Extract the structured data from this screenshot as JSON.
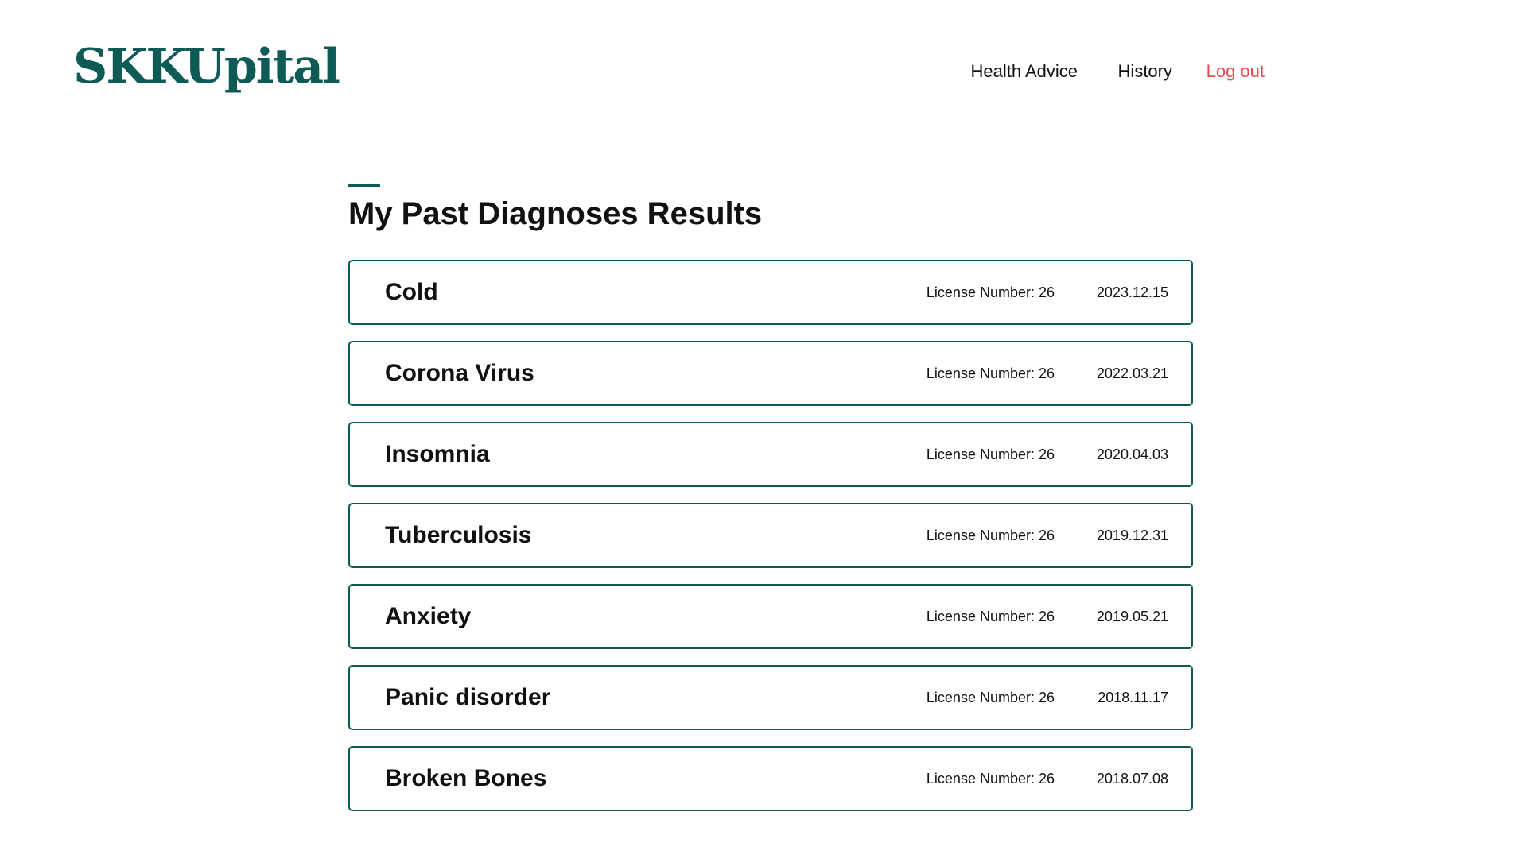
{
  "header": {
    "logo": "SKKUpital",
    "nav": {
      "health_advice": "Health Advice",
      "history": "History",
      "logout": "Log out"
    }
  },
  "main": {
    "title": "My Past Diagnoses Results",
    "diagnoses": [
      {
        "name": "Cold",
        "license": "License Number: 26",
        "date": "2023.12.15"
      },
      {
        "name": "Corona Virus",
        "license": "License Number: 26",
        "date": "2022.03.21"
      },
      {
        "name": "Insomnia",
        "license": "License Number: 26",
        "date": "2020.04.03"
      },
      {
        "name": "Tuberculosis",
        "license": "License Number: 26",
        "date": "2019.12.31"
      },
      {
        "name": "Anxiety",
        "license": "License Number: 26",
        "date": "2019.05.21"
      },
      {
        "name": "Panic disorder",
        "license": "License Number: 26",
        "date": "2018.11.17"
      },
      {
        "name": "Broken Bones",
        "license": "License Number: 26",
        "date": "2018.07.08"
      }
    ]
  },
  "colors": {
    "brand": "#0e5a55",
    "logout": "#e8484f",
    "text": "#111111",
    "background": "#ffffff"
  }
}
